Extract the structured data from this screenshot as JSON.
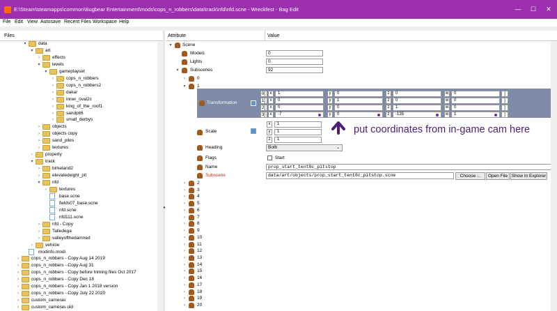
{
  "window": {
    "title": "E:\\Steam\\steamapps\\common\\Bugbear Entertainment\\mods\\cops_n_robbers\\data\\track\\nfd\\nfd.scne - Wreckfest - Bag Edit",
    "minimize": "—",
    "maximize": "☐",
    "close": "✕"
  },
  "menu": [
    "File",
    "Edit",
    "View",
    "Autosave",
    "Recent Files",
    "Workspace",
    "Help"
  ],
  "files": {
    "header": "Files",
    "tree": [
      {
        "label": "data",
        "depth": 3,
        "type": "folder",
        "expanded": true
      },
      {
        "label": "art",
        "depth": 4,
        "type": "folder",
        "expanded": true
      },
      {
        "label": "effects",
        "depth": 5,
        "type": "folder",
        "expanded": false
      },
      {
        "label": "levels",
        "depth": 5,
        "type": "folder",
        "expanded": true
      },
      {
        "label": "gameplayset",
        "depth": 6,
        "type": "folder",
        "expanded": true
      },
      {
        "label": "cops_n_robbers",
        "depth": 7,
        "type": "folder",
        "expanded": false
      },
      {
        "label": "cops_n_robbers2",
        "depth": 7,
        "type": "folder",
        "expanded": false
      },
      {
        "label": "dakar",
        "depth": 7,
        "type": "folder",
        "expanded": false
      },
      {
        "label": "inner_oval2c",
        "depth": 7,
        "type": "folder",
        "expanded": false
      },
      {
        "label": "king_of_the_roof1",
        "depth": 7,
        "type": "folder",
        "expanded": false
      },
      {
        "label": "sandpit6",
        "depth": 7,
        "type": "folder",
        "expanded": false
      },
      {
        "label": "small_derbys",
        "depth": 7,
        "type": "folder",
        "expanded": false
      },
      {
        "label": "objects",
        "depth": 5,
        "type": "folder",
        "expanded": false
      },
      {
        "label": "objects copy",
        "depth": 5,
        "type": "folder",
        "expanded": false
      },
      {
        "label": "sand_piles",
        "depth": 5,
        "type": "folder",
        "expanded": false
      },
      {
        "label": "textures",
        "depth": 5,
        "type": "folder",
        "expanded": false
      },
      {
        "label": "property",
        "depth": 4,
        "type": "folder",
        "expanded": false
      },
      {
        "label": "track",
        "depth": 4,
        "type": "folder",
        "expanded": true
      },
      {
        "label": "birkeland2",
        "depth": 5,
        "type": "folder",
        "expanded": false
      },
      {
        "label": "elevatedeight_pit",
        "depth": 5,
        "type": "folder",
        "expanded": false
      },
      {
        "label": "nfd",
        "depth": 5,
        "type": "folder",
        "expanded": true
      },
      {
        "label": "textures",
        "depth": 6,
        "type": "folder",
        "expanded": false
      },
      {
        "label": "base.scne",
        "depth": 6,
        "type": "file"
      },
      {
        "label": "fields07_base.scne",
        "depth": 6,
        "type": "file"
      },
      {
        "label": "nfd.scne",
        "depth": 6,
        "type": "file"
      },
      {
        "label": "nfd111.scne",
        "depth": 6,
        "type": "file"
      },
      {
        "label": "nfd - Copy",
        "depth": 5,
        "type": "folder",
        "expanded": false
      },
      {
        "label": "Talledega",
        "depth": 5,
        "type": "folder",
        "expanded": false
      },
      {
        "label": "valleyofthedamned",
        "depth": 5,
        "type": "folder",
        "expanded": false
      },
      {
        "label": "vehicle",
        "depth": 4,
        "type": "folder",
        "expanded": false
      },
      {
        "label": "modinfo.modi",
        "depth": 3,
        "type": "file"
      },
      {
        "label": "cops_n_robbers - Copy Aug 14 2019",
        "depth": 2,
        "type": "folder",
        "expanded": false
      },
      {
        "label": "cops_n_robbers - Copy Aug 31",
        "depth": 2,
        "type": "folder",
        "expanded": false
      },
      {
        "label": "cops_n_robbers - Copy before triming files Oct 2017",
        "depth": 2,
        "type": "folder",
        "expanded": false
      },
      {
        "label": "cops_n_robbers - Copy Dec 18",
        "depth": 2,
        "type": "folder",
        "expanded": false
      },
      {
        "label": "cops_n_robbers - Copy Jan 1 2018 version",
        "depth": 2,
        "type": "folder",
        "expanded": false
      },
      {
        "label": "cops_n_robbers - Copy July 22  2020",
        "depth": 2,
        "type": "folder",
        "expanded": false
      },
      {
        "label": "custom_cameras",
        "depth": 2,
        "type": "folder",
        "expanded": false
      },
      {
        "label": "custom_cameras old",
        "depth": 2,
        "type": "folder",
        "expanded": false
      }
    ]
  },
  "attributes": {
    "header_attr": "Attribute",
    "header_value": "Value",
    "scene": "Scene",
    "models_label": "Models",
    "models_value": "0",
    "lights_label": "Lights",
    "lights_value": "0",
    "subscenes_label": "Subscenes",
    "subscenes_value": "92",
    "idx0": "0",
    "idx1": "1",
    "transformation_label": "Transformation",
    "matrix": [
      {
        "row": "0[",
        "x": "1",
        "y": "0",
        "z": "0",
        "w": "0"
      },
      {
        "row": "1[",
        "x": "0",
        "y": "1",
        "z": "0",
        "w": "0"
      },
      {
        "row": "2[",
        "x": "0",
        "y": "0",
        "z": "1",
        "w": "0"
      },
      {
        "row": "3[",
        "x": "-7",
        "y": "0",
        "z": "-135",
        "w": "1"
      }
    ],
    "axis_x": "x",
    "axis_y": "y",
    "axis_z": "z",
    "axis_w": "w",
    "close_bracket": "]",
    "scale_label": "Scale",
    "scale": {
      "x": "1",
      "y": "1",
      "z": "1"
    },
    "heading_label": "Heading",
    "heading_value": "Both",
    "flags_label": "Flags",
    "flags_value": "Start",
    "name_label": "Name",
    "name_value": "prop_start_tent8c_pitstop",
    "subscene_label": "Subscene",
    "subscene_value": "data/art/objects/prop_start_tent8c_pitstop.scne",
    "choose_btn": "Choose ...",
    "open_file_btn": "Open File",
    "show_explorer_btn": "Show In Explorer",
    "more_indices": [
      "2",
      "3",
      "4",
      "5",
      "6",
      "7",
      "8",
      "9",
      "10",
      "11",
      "12",
      "13",
      "14",
      "15",
      "16",
      "17",
      "18",
      "19",
      "20"
    ]
  },
  "annotation": "put coordinates from in-game cam here",
  "colors": {
    "titlebar": "#9b2fae",
    "selection": "#7d8aa8",
    "annotation": "#4a1f74",
    "subscene_text": "#d02020"
  }
}
